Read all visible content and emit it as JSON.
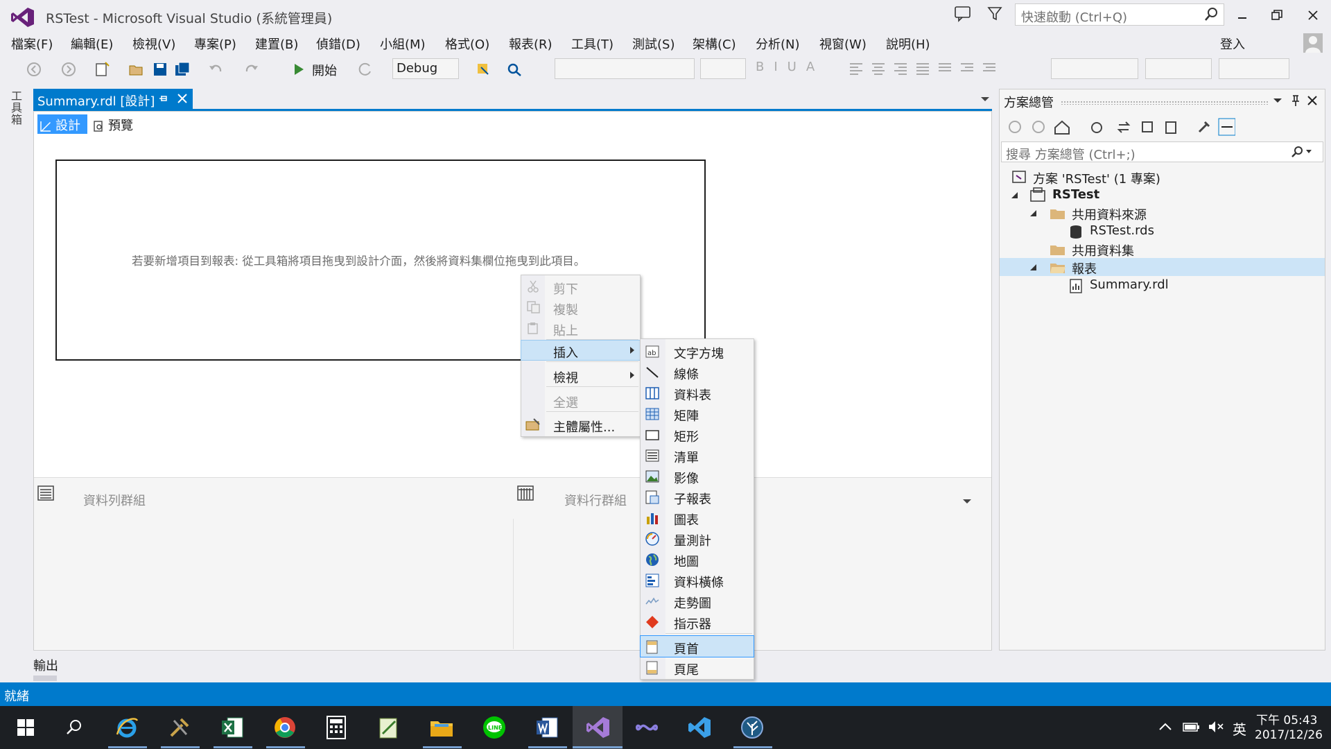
{
  "window": {
    "title": "RSTest - Microsoft Visual Studio (系統管理員)",
    "quick_launch_placeholder": "快速啟動 (Ctrl+Q)",
    "sign_in": "登入"
  },
  "menubar": [
    "檔案(F)",
    "編輯(E)",
    "檢視(V)",
    "專案(P)",
    "建置(B)",
    "偵錯(D)",
    "小組(M)",
    "格式(O)",
    "報表(R)",
    "工具(T)",
    "測試(S)",
    "架構(C)",
    "分析(N)",
    "視窗(W)",
    "說明(H)"
  ],
  "toolbar": {
    "start_label": "開始",
    "config": "Debug"
  },
  "left_strip": {
    "toolbox_label": "工具箱"
  },
  "doc": {
    "tab_title": "Summary.rdl [設計]",
    "design_tab": "設計",
    "preview_tab": "預覽",
    "hint": "若要新增項目到報表: 從工具箱將項目拖曳到設計介面，然後將資料集欄位拖曳到此項目。",
    "row_groups": "資料列群組",
    "column_groups": "資料行群組"
  },
  "context_menu": {
    "items": [
      {
        "label": "剪下",
        "enabled": false
      },
      {
        "label": "複製",
        "enabled": false
      },
      {
        "label": "貼上",
        "enabled": false
      },
      {
        "label": "插入",
        "enabled": true,
        "submenu": true,
        "highlighted": true
      },
      {
        "label": "檢視",
        "enabled": true,
        "submenu": true
      },
      {
        "label": "全選",
        "enabled": false
      },
      {
        "label": "主體屬性...",
        "enabled": true
      }
    ]
  },
  "insert_submenu": {
    "items": [
      {
        "label": "文字方塊",
        "icon": "textbox-icon"
      },
      {
        "label": "線條",
        "icon": "line-icon"
      },
      {
        "label": "資料表",
        "icon": "table-icon"
      },
      {
        "label": "矩陣",
        "icon": "matrix-icon"
      },
      {
        "label": "矩形",
        "icon": "rectangle-icon"
      },
      {
        "label": "清單",
        "icon": "list-icon"
      },
      {
        "label": "影像",
        "icon": "image-icon"
      },
      {
        "label": "子報表",
        "icon": "subreport-icon"
      },
      {
        "label": "圖表",
        "icon": "chart-icon"
      },
      {
        "label": "量測計",
        "icon": "gauge-icon"
      },
      {
        "label": "地圖",
        "icon": "map-icon"
      },
      {
        "label": "資料橫條",
        "icon": "databar-icon"
      },
      {
        "label": "走勢圖",
        "icon": "sparkline-icon"
      },
      {
        "label": "指示器",
        "icon": "indicator-icon"
      },
      {
        "label": "頁首",
        "icon": "page-header-icon",
        "highlighted": true
      },
      {
        "label": "頁尾",
        "icon": "page-footer-icon"
      }
    ]
  },
  "solution_explorer": {
    "title": "方案總管",
    "search_placeholder": "搜尋 方案總管 (Ctrl+;)",
    "tree": [
      {
        "label": "方案 'RSTest' (1 專案)",
        "level": 0,
        "icon": "solution-icon"
      },
      {
        "label": "RSTest",
        "level": 1,
        "icon": "project-icon",
        "bold": true
      },
      {
        "label": "共用資料來源",
        "level": 2,
        "icon": "folder-icon"
      },
      {
        "label": "RSTest.rds",
        "level": 3,
        "icon": "datasource-icon"
      },
      {
        "label": "共用資料集",
        "level": 2,
        "icon": "folder-icon"
      },
      {
        "label": "報表",
        "level": 2,
        "icon": "folder-icon",
        "selected": true
      },
      {
        "label": "Summary.rdl",
        "level": 3,
        "icon": "report-icon"
      }
    ]
  },
  "output_tab": "輸出",
  "status": {
    "text": "就緒",
    "accent": "#007acc"
  },
  "tray": {
    "time": "下午 05:43",
    "date": "2017/12/26",
    "ime": "英"
  }
}
